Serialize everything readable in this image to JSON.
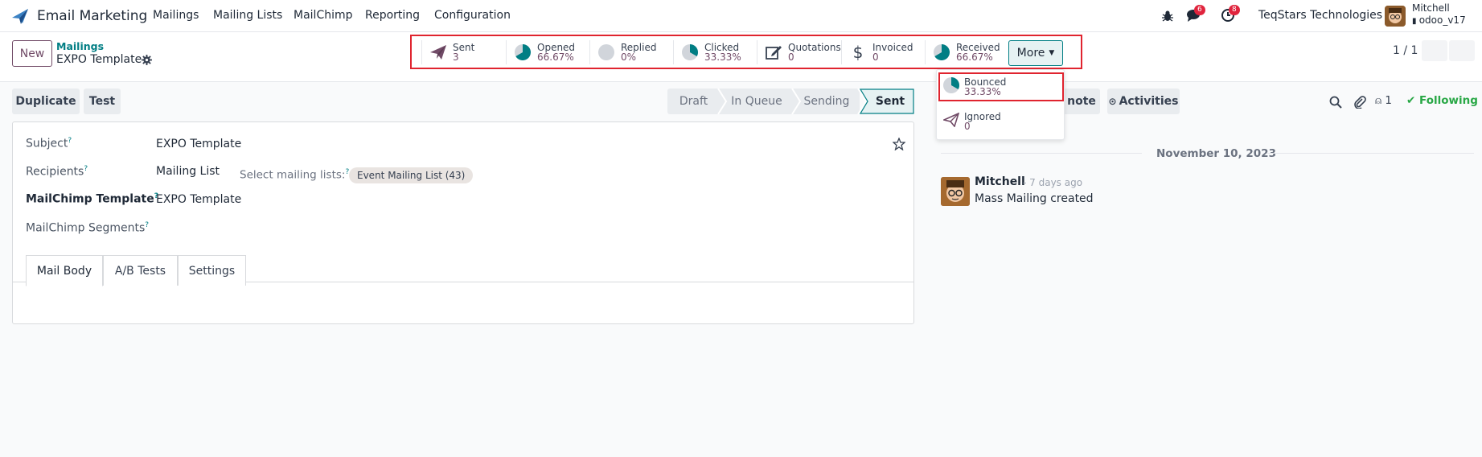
{
  "navbar": {
    "app_name": "Email Marketing",
    "menu": [
      "Mailings",
      "Mailing Lists",
      "MailChimp",
      "Reporting",
      "Configuration"
    ],
    "messages_badge": "6",
    "activities_badge": "8",
    "company": "TeqStars Technologies",
    "user_name": "Mitchell",
    "user_db": "odoo_v17"
  },
  "control": {
    "new_label": "New",
    "breadcrumb_parent": "Mailings",
    "breadcrumb_current": "EXPO Template",
    "pager": "1 / 1",
    "more_label": "More"
  },
  "stats": [
    {
      "label": "Sent",
      "value": "3",
      "icon": "paper-plane-icon"
    },
    {
      "label": "Opened",
      "value": "66.67%",
      "icon": "pie-chart-icon"
    },
    {
      "label": "Replied",
      "value": "0%",
      "icon": "pie-chart-icon"
    },
    {
      "label": "Clicked",
      "value": "33.33%",
      "icon": "pie-chart-icon"
    },
    {
      "label": "Quotations",
      "value": "0",
      "icon": "edit-icon"
    },
    {
      "label": "Invoiced",
      "value": "0",
      "icon": "dollar-icon"
    },
    {
      "label": "Received",
      "value": "66.67%",
      "icon": "pie-chart-icon"
    }
  ],
  "more_dropdown": [
    {
      "label": "Bounced",
      "value": "33.33%",
      "icon": "pie-chart-icon"
    },
    {
      "label": "Ignored",
      "value": "0",
      "icon": "paper-plane-icon"
    }
  ],
  "actions": {
    "duplicate": "Duplicate",
    "test": "Test",
    "stages": [
      "Draft",
      "In Queue",
      "Sending",
      "Sent"
    ],
    "active_stage": "Sent"
  },
  "chatter_bar": {
    "log_note": "note",
    "activities": "Activities",
    "followers_count": "1",
    "following": "Following"
  },
  "form": {
    "subject_label": "Subject",
    "subject_value": "EXPO Template",
    "recipients_label": "Recipients",
    "recipients_value": "Mailing List",
    "select_lists_label": "Select mailing lists:",
    "mailing_list_tag": "Event Mailing List (43)",
    "template_label": "MailChimp Template",
    "template_value": "EXPO Template",
    "segments_label": "MailChimp Segments",
    "tooltip_mark": "?",
    "tabs": [
      "Mail Body",
      "A/B Tests",
      "Settings"
    ]
  },
  "chatter": {
    "date": "November 10, 2023",
    "author": "Mitchell",
    "time": "- 7 days ago",
    "body": "Mass Mailing created"
  },
  "colors": {
    "brand": "#714b67",
    "accent": "#017e84",
    "highlight_border": "#e0242f",
    "success": "#28a745"
  }
}
